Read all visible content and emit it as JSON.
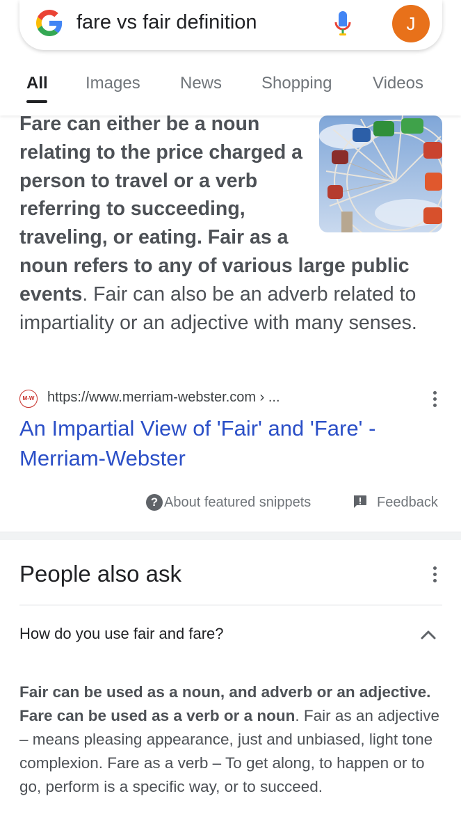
{
  "search": {
    "query": "fare vs fair definition",
    "avatar_letter": "J"
  },
  "tabs": [
    "All",
    "Images",
    "News",
    "Shopping",
    "Videos"
  ],
  "active_tab": "All",
  "snippet": {
    "bold_text": "Fare can either be a noun relating to the price charged a person to travel or a verb referring to succeeding, traveling, or eating. Fair as a noun refers to any of various large public events",
    "regular_text": ". Fair can also be an adverb related to impartiality or an adjective with many senses.",
    "image_alt": "Ferris wheel at a fair"
  },
  "source": {
    "favicon_label": "M-W",
    "url": "https://www.merriam-webster.com › ...",
    "title": "An Impartial View of 'Fair' and 'Fare' - Merriam-Webster"
  },
  "meta": {
    "about_label": "About featured snippets",
    "feedback_label": "Feedback"
  },
  "people_also_ask": {
    "title": "People also ask",
    "question": "How do you use fair and fare?",
    "answer_bold": "Fair can be used as a noun, and adverb or an adjective. Fare can be used as a verb or a noun",
    "answer_regular": ". Fair as an adjective – means pleasing appearance, just and unbiased, light tone complexion. Fare as a verb – To get along, to happen or to go, perform is a specific way, or to succeed."
  },
  "colors": {
    "link": "#2b4fc7",
    "avatar_bg": "#e8711a",
    "text": "#4d5156"
  }
}
